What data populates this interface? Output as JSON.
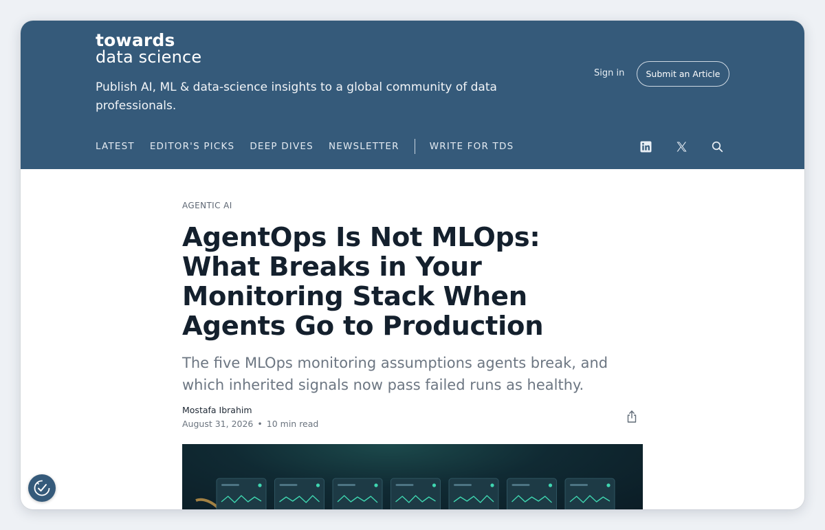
{
  "site": {
    "logo_line1": "towards",
    "logo_line2": "data science",
    "tagline": "Publish AI, ML & data-science insights to a global community of data professionals."
  },
  "header": {
    "signin_label": "Sign in",
    "submit_label": "Submit an Article"
  },
  "nav": {
    "items": [
      "LATEST",
      "EDITOR'S PICKS",
      "DEEP DIVES",
      "NEWSLETTER"
    ],
    "write_label": "WRITE FOR TDS"
  },
  "social": {
    "icons": [
      "linkedin-icon",
      "x-icon",
      "search-icon"
    ]
  },
  "article": {
    "category": "AGENTIC AI",
    "title": "AgentOps Is Not MLOps: What Breaks in Your Monitoring Stack When Agents Go to Production",
    "subtitle": "The five MLOps monitoring assumptions agents break, and which inherited signals now pass failed runs as healthy.",
    "author": "Mostafa Ibrahim",
    "date": "August 31, 2026",
    "separator": "•",
    "read_time": "10 min read"
  },
  "colors": {
    "header_bg": "#355a7a",
    "title_text": "#14202d",
    "subtitle_text": "#6c7682",
    "hero_accent": "#3fd6b0"
  }
}
